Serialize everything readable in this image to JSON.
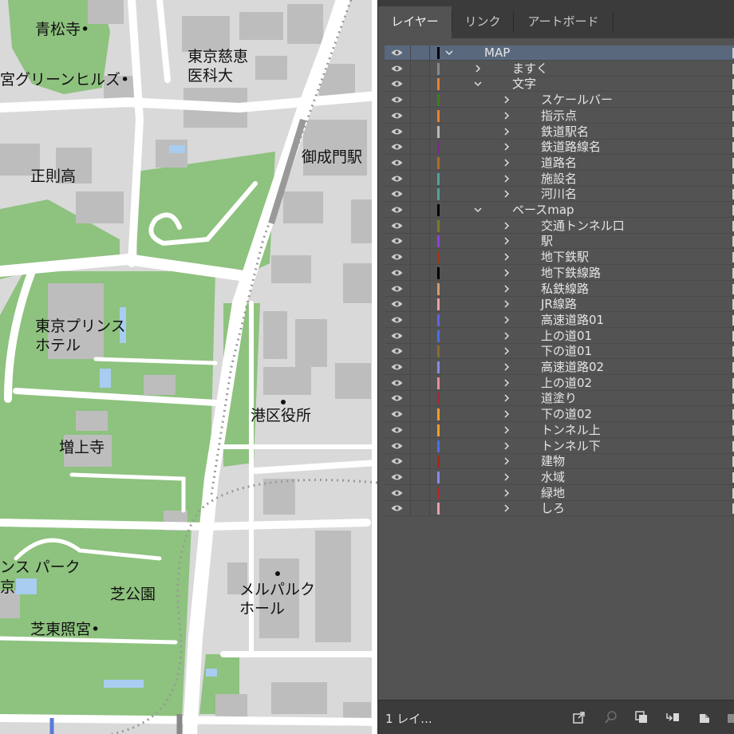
{
  "map": {
    "labels": [
      {
        "key": "seishoji",
        "text": "青松寺•"
      },
      {
        "key": "jikei1",
        "text": "東京慈恵"
      },
      {
        "key": "jikei2",
        "text": "医科大"
      },
      {
        "key": "green_hills",
        "text": "宮グリーンヒルズ•"
      },
      {
        "key": "onarimon",
        "text": "御成門駅"
      },
      {
        "key": "seisoku",
        "text": "正則高"
      },
      {
        "key": "prince1",
        "text": "東京プリンス"
      },
      {
        "key": "prince2",
        "text": "ホテル"
      },
      {
        "key": "minato",
        "text": "港区役所"
      },
      {
        "key": "zojoji",
        "text": "増上寺"
      },
      {
        "key": "park1",
        "text": "ンス パーク"
      },
      {
        "key": "park2",
        "text": "京"
      },
      {
        "key": "shiba_koen",
        "text": "芝公園"
      },
      {
        "key": "toshogu",
        "text": "芝東照宮•"
      },
      {
        "key": "melparque1",
        "text": "メルパルク"
      },
      {
        "key": "melparque2",
        "text": "ホール"
      }
    ],
    "colors": {
      "base": "#d9d9d9",
      "green": "#8ec27f",
      "building": "#bdbdbd",
      "road": "#ffffff",
      "water": "#a8cdf0",
      "rail": "#999999"
    }
  },
  "panel": {
    "tabs": [
      {
        "label": "レイヤー",
        "active": true
      },
      {
        "label": "リンク",
        "active": false
      },
      {
        "label": "アートボード",
        "active": false
      }
    ],
    "layers": [
      {
        "name": "MAP",
        "color": "#000000",
        "chevron": "down",
        "selected": true
      },
      {
        "name": "ますく",
        "color": "#8a8a8a",
        "chevron": "right"
      },
      {
        "name": "文字",
        "color": "#f07f2e",
        "chevron": "down"
      },
      {
        "name": "スケールバー",
        "color": "#3f7d1f",
        "chevron": "right"
      },
      {
        "name": "指示点",
        "color": "#f07f2e",
        "chevron": "right"
      },
      {
        "name": "鉄道駅名",
        "color": "#b9b9b9",
        "chevron": "right"
      },
      {
        "name": "鉄道路線名",
        "color": "#7d2a8a",
        "chevron": "right"
      },
      {
        "name": "道路名",
        "color": "#b56c1e",
        "chevron": "right"
      },
      {
        "name": "施設名",
        "color": "#4ea3a3",
        "chevron": "right"
      },
      {
        "name": "河川名",
        "color": "#4ea3a3",
        "chevron": "right"
      },
      {
        "name": "ベースmap",
        "color": "#000000",
        "chevron": "down"
      },
      {
        "name": "交通トンネル口",
        "color": "#7a7d22",
        "chevron": "right"
      },
      {
        "name": "駅",
        "color": "#8f3fe0",
        "chevron": "right"
      },
      {
        "name": "地下鉄駅",
        "color": "#9b3a14",
        "chevron": "right"
      },
      {
        "name": "地下鉄線路",
        "color": "#000000",
        "chevron": "right"
      },
      {
        "name": "私鉄線路",
        "color": "#d59a6e",
        "chevron": "right"
      },
      {
        "name": "JR線路",
        "color": "#f0a0a0",
        "chevron": "right"
      },
      {
        "name": "高速道路01",
        "color": "#5a67e8",
        "chevron": "right"
      },
      {
        "name": "上の道01",
        "color": "#4a6fe8",
        "chevron": "right"
      },
      {
        "name": "下の道01",
        "color": "#8a6a2a",
        "chevron": "right"
      },
      {
        "name": "高速道路02",
        "color": "#8a8ae8",
        "chevron": "right"
      },
      {
        "name": "上の道02",
        "color": "#f08a9a",
        "chevron": "right"
      },
      {
        "name": "道塗り",
        "color": "#a02a3a",
        "chevron": "right"
      },
      {
        "name": "下の道02",
        "color": "#f0a020",
        "chevron": "right"
      },
      {
        "name": "トンネル上",
        "color": "#f0a020",
        "chevron": "right"
      },
      {
        "name": "トンネル下",
        "color": "#4a6fe8",
        "chevron": "right"
      },
      {
        "name": "建物",
        "color": "#a02a1a",
        "chevron": "right"
      },
      {
        "name": "水域",
        "color": "#8a8ae8",
        "chevron": "right"
      },
      {
        "name": "緑地",
        "color": "#b0282a",
        "chevron": "right"
      },
      {
        "name": "しろ",
        "color": "#f0a0a8",
        "chevron": "right"
      }
    ],
    "footer": {
      "count": "1 レイ...",
      "icons": [
        "export-icon",
        "search-icon",
        "clip-mask-icon",
        "sublayer-icon",
        "new-layer-icon",
        "delete-icon"
      ]
    }
  }
}
